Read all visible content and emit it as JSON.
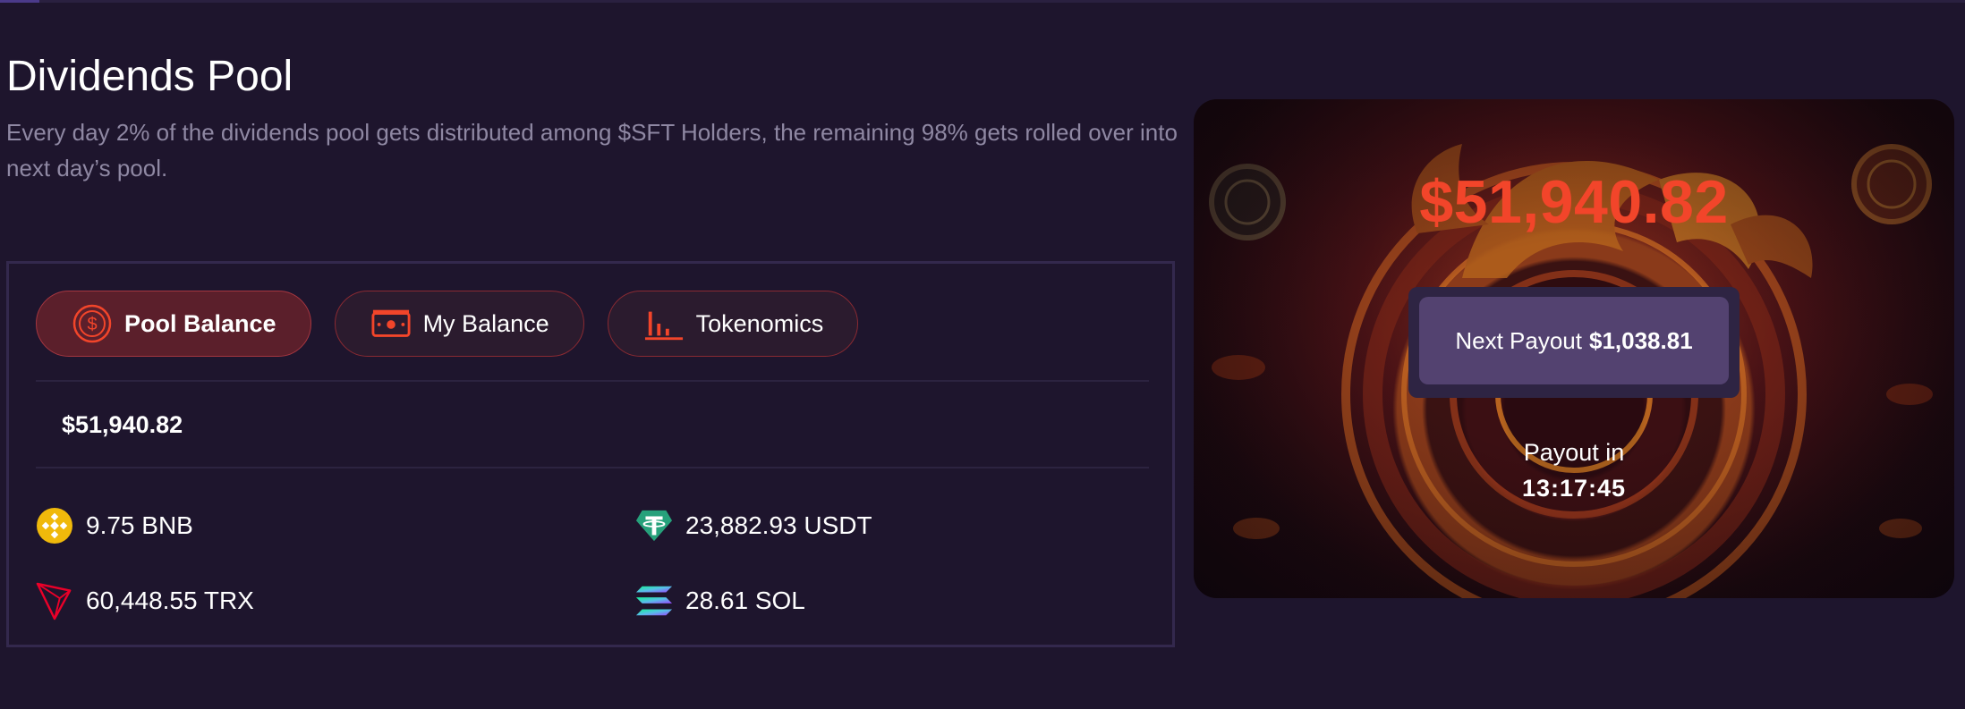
{
  "header": {
    "title": "Dividends Pool",
    "description": "Every day 2% of the dividends pool gets distributed among $SFT Holders, the remaining 98% gets rolled over into next day’s pool."
  },
  "tabs": [
    {
      "label": "Pool Balance",
      "icon": "dollar-coin-icon",
      "active": true
    },
    {
      "label": "My Balance",
      "icon": "cash-icon",
      "active": false
    },
    {
      "label": "Tokenomics",
      "icon": "bar-chart-icon",
      "active": false
    }
  ],
  "pool": {
    "total": "$51,940.82",
    "assets": [
      {
        "name": "BNB",
        "amount": "9.75 BNB",
        "icon": "bnb-icon"
      },
      {
        "name": "USDT",
        "amount": "23,882.93 USDT",
        "icon": "tether-icon"
      },
      {
        "name": "TRX",
        "amount": "60,448.55 TRX",
        "icon": "tron-icon"
      },
      {
        "name": "SOL",
        "amount": "28.61 SOL",
        "icon": "solana-icon"
      }
    ]
  },
  "hero": {
    "amount": "$51,940.82",
    "next_payout_label": "Next Payout",
    "next_payout_value": "$1,038.81",
    "payout_in_label": "Payout in",
    "countdown": "13:17:45"
  },
  "colors": {
    "background": "#1e152d",
    "accent_red": "#f2452a",
    "tab_border": "#8a2a32",
    "payout_button": "#534270",
    "muted_text": "#8f88a3"
  }
}
